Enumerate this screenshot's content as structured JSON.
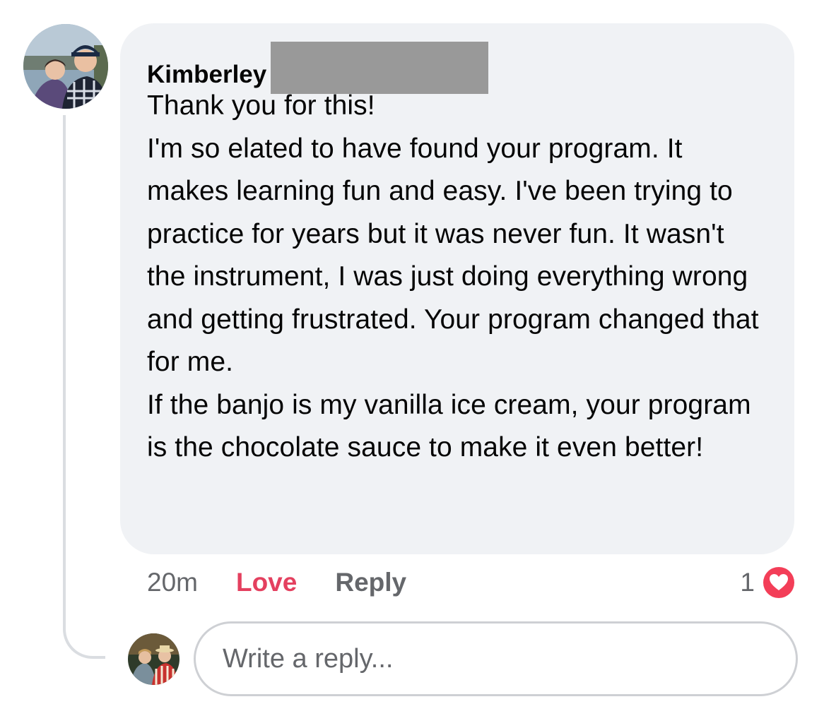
{
  "comment": {
    "author_name": "Kimberley",
    "author_avatar_icon": "profile-photo-couple",
    "text": "Thank you for this!\nI'm so elated to have found your program. It makes learning fun and easy. I've been trying to practice for years but it was never fun. It wasn't the instrument, I was just doing everything wrong and getting frustrated. Your program changed that for me.\nIf the banjo is my vanilla ice cream, your program is the chocolate sauce to make it even better!"
  },
  "actions": {
    "time": "20m",
    "love_label": "Love",
    "reply_label": "Reply",
    "reaction_count": "1",
    "reaction_icon": "heart-icon"
  },
  "reply_box": {
    "placeholder": "Write a reply...",
    "value": "",
    "avatar_icon": "profile-photo-user"
  },
  "colors": {
    "bubble": "#f0f2f5",
    "love": "#e4405f",
    "muted": "#65676b",
    "heart": "#f33e58"
  }
}
